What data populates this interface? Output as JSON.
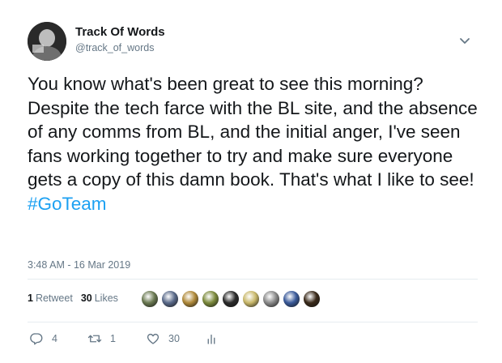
{
  "author": {
    "display_name": "Track Of Words",
    "handle": "@track_of_words",
    "avatar_icon": "avatar-photo"
  },
  "tweet": {
    "text": "You know what's been great to see this morning? Despite the tech farce with the BL site, and the absence of any comms from BL, and the initial anger, I've seen fans working together to try and make sure everyone gets a copy of this damn book. That's what I like to see! ",
    "hashtag": "#GoTeam",
    "hashtag_color": "#1da1f2",
    "timestamp": "3:48 AM - 16 Mar 2019"
  },
  "stats": {
    "retweets_count": "1",
    "retweets_label": "Retweet",
    "likes_count": "30",
    "likes_label": "Likes",
    "liker_avatars": [
      {
        "color": "#6b7a52"
      },
      {
        "color": "#5a6a8a"
      },
      {
        "color": "#b08a3a"
      },
      {
        "color": "#7c8a3c"
      },
      {
        "color": "#2b2b2b"
      },
      {
        "color": "#c9b86a"
      },
      {
        "color": "#8a8a8a"
      },
      {
        "color": "#3a5a9a"
      },
      {
        "color": "#3a2a1a"
      }
    ]
  },
  "actions": {
    "reply_count": "4",
    "retweet_count": "1",
    "like_count": "30",
    "reply_icon": "reply-icon",
    "retweet_icon": "retweet-icon",
    "like_icon": "heart-icon",
    "analytics_icon": "analytics-icon"
  },
  "colors": {
    "secondary_text": "#657786",
    "primary_text": "#14171a",
    "accent": "#1da1f2"
  }
}
